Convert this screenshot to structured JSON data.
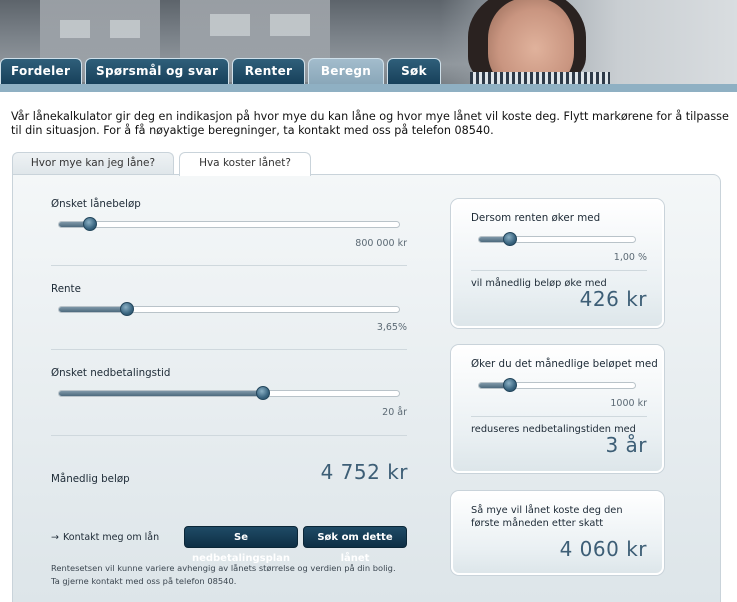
{
  "nav": {
    "tabs": [
      {
        "label": "Fordeler"
      },
      {
        "label": "Spørsmål og svar"
      },
      {
        "label": "Renter"
      },
      {
        "label": "Beregn"
      },
      {
        "label": "Søk"
      }
    ]
  },
  "intro": "Vår lånekalkulator gir deg en indikasjon på hvor mye du kan låne og hvor mye lånet vil koste deg. Flytt markørene for å tilpasse til din situasjon. For å få nøyaktige beregninger, ta kontakt med oss på telefon 08540.",
  "subtabs": [
    {
      "label": "Hvor mye kan jeg låne?"
    },
    {
      "label": "Hva koster lånet?"
    }
  ],
  "sliders": {
    "amount": {
      "label": "Ønsket lånebeløp",
      "value": "800 000 kr",
      "position": 0.09
    },
    "rate": {
      "label": "Rente",
      "value": "3,65%",
      "position": 0.2
    },
    "term": {
      "label": "Ønsket nedbetalingstid",
      "value": "20 år",
      "position": 0.6
    }
  },
  "monthly": {
    "label": "Månedlig beløp",
    "value": "4 752 kr"
  },
  "rate_increase": {
    "label": "Dersom renten øker med",
    "value": "1,00 %",
    "position": 0.2,
    "result_label": "vil månedlig beløp øke med",
    "result_value": "426 kr"
  },
  "payment_increase": {
    "label": "Øker du det månedlige beløpet med",
    "value": "1000 kr",
    "position": 0.2,
    "result_label": "reduseres nedbetalingstiden med",
    "result_value": "3 år"
  },
  "first_month": {
    "line1": "Så mye vil lånet koste deg den",
    "line2": "første måneden etter skatt",
    "value": "4 060 kr"
  },
  "actions": {
    "contact_link": "Kontakt meg om lån",
    "plan_button": "Se nedbetalingsplan",
    "apply_button": "Søk om dette lånet"
  },
  "notes": {
    "line1": "Rentesetsen vil kunne variere avhengig av lånets størrelse og verdien på din bolig.",
    "line2": "Ta gjerne kontakt med oss på telefon 08540."
  },
  "colors": {
    "brand": "#17405a",
    "accent": "#3d5e76",
    "tab_active": "#8aa7b9"
  }
}
